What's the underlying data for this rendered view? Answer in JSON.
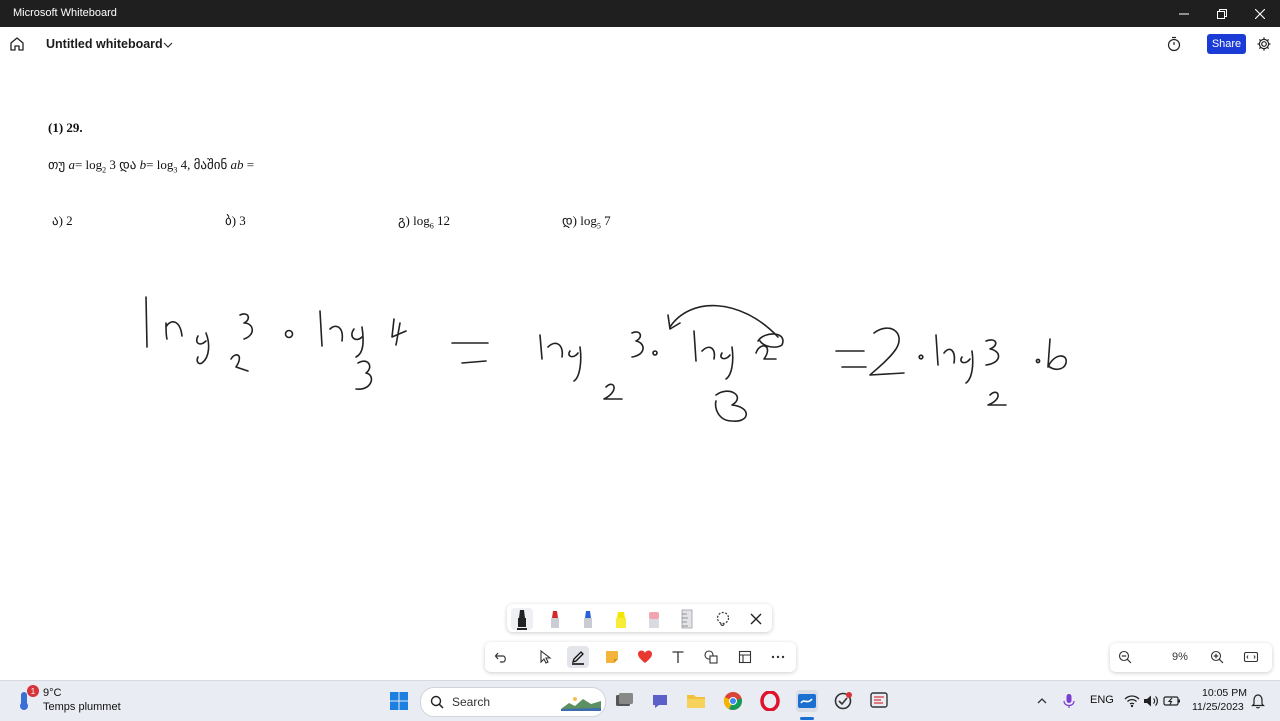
{
  "window": {
    "title": "Microsoft Whiteboard"
  },
  "appbar": {
    "whiteboard_title": "Untitled whiteboard",
    "share_label": "Share"
  },
  "document": {
    "problem_number": "(1) 29.",
    "question": {
      "prefix": "თუ",
      "a_var": "a",
      "a_expr": "= log",
      "a_base": "2",
      "a_arg": "3",
      "conj": "და",
      "b_var": "b",
      "b_expr": "= log",
      "b_base": "3",
      "b_arg": "4,",
      "then": "მაშინ",
      "ab": "ab",
      "eq": "="
    },
    "answers": [
      {
        "label": "ა) 2"
      },
      {
        "label": "ბ) 3"
      },
      {
        "label": "გ) log",
        "base": "6",
        "arg": "12"
      },
      {
        "label": "დ) log",
        "base": "5",
        "arg": "7"
      }
    ]
  },
  "toolbar": {
    "zoom_level": "9%"
  },
  "taskbar": {
    "weather_temp": "9°C",
    "weather_desc": "Temps plummet",
    "weather_badge": "1",
    "search_label": "Search",
    "language": "ENG",
    "time": "10:05 PM",
    "date": "11/25/2023"
  },
  "colors": {
    "accent": "#1b3bd6",
    "titlebar": "#1f1f1f",
    "ink": "#222222",
    "taskbar": "#e9ecf3"
  }
}
